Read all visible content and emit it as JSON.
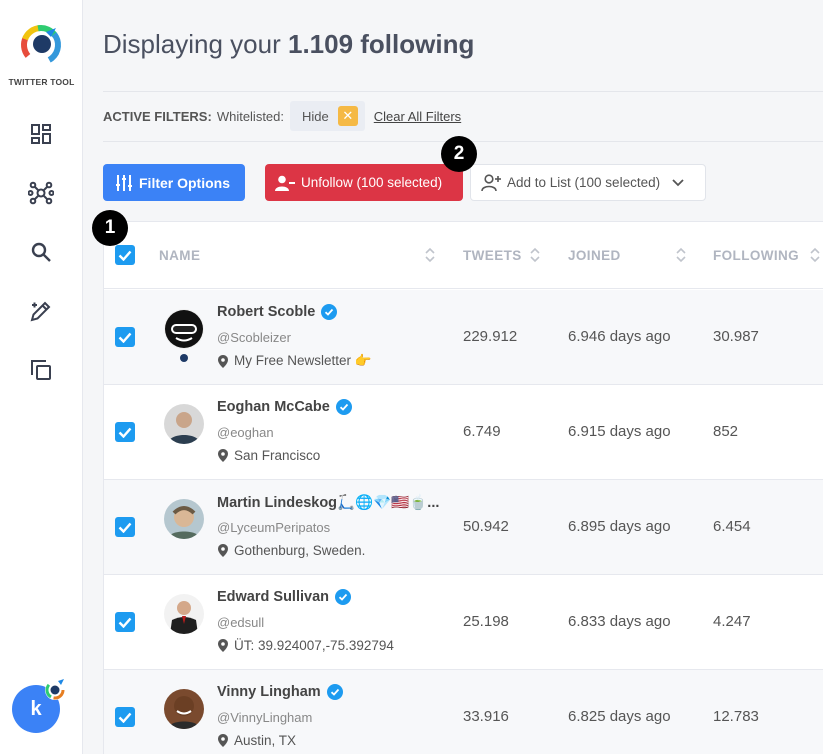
{
  "app": {
    "name": "TWITTER TOOL"
  },
  "header": {
    "title_prefix": "Displaying your ",
    "title_count": "1.109 following"
  },
  "filters": {
    "label": "ACTIVE FILTERS:",
    "whitelisted_label": "Whitelisted:",
    "chip_value": "Hide",
    "chip_remove_glyph": "✕",
    "clear_all": "Clear All Filters"
  },
  "toolbar": {
    "filter_options": "Filter Options",
    "unfollow": "Unfollow (100 selected)",
    "add_to_list": "Add to List (100 selected)"
  },
  "annotations": {
    "one": "1",
    "two": "2"
  },
  "table": {
    "columns": [
      "NAME",
      "TWEETS",
      "JOINED",
      "FOLLOWING"
    ],
    "rows": [
      {
        "name": "Robert Scoble",
        "handle": "@Scobleizer",
        "location": "My Free Newsletter 👉",
        "tweets": "229.912",
        "joined": "6.946 days ago",
        "following": "30.987",
        "checked": true
      },
      {
        "name": "Eoghan McCabe",
        "handle": "@eoghan",
        "location": "San Francisco",
        "tweets": "6.749",
        "joined": "6.915 days ago",
        "following": "852",
        "checked": true
      },
      {
        "name": "Martin Lindeskog🛴🌐💎🇺🇸🍵...",
        "handle": "@LyceumPeripatos",
        "location": "Gothenburg, Sweden.",
        "tweets": "50.942",
        "joined": "6.895 days ago",
        "following": "6.454",
        "checked": true
      },
      {
        "name": "Edward Sullivan",
        "handle": "@edsull",
        "location": "ÜT: 39.924007,-75.392794",
        "tweets": "25.198",
        "joined": "6.833 days ago",
        "following": "4.247",
        "checked": true
      },
      {
        "name": "Vinny Lingham",
        "handle": "@VinnyLingham",
        "location": "Austin, TX",
        "tweets": "33.916",
        "joined": "6.825 days ago",
        "following": "12.783",
        "checked": true
      }
    ]
  },
  "user": {
    "avatar_letter": "k"
  },
  "colors": {
    "primary": "#3b82f6",
    "danger": "#dc3545",
    "checkbox": "#1d9bf0",
    "chip_remove": "#f5b945"
  },
  "icons": {
    "sidebar": [
      "dashboard-icon",
      "network-icon",
      "search-icon",
      "edit-icon",
      "copy-icon"
    ],
    "verified": "verified-badge-icon",
    "location": "location-pin-icon"
  }
}
